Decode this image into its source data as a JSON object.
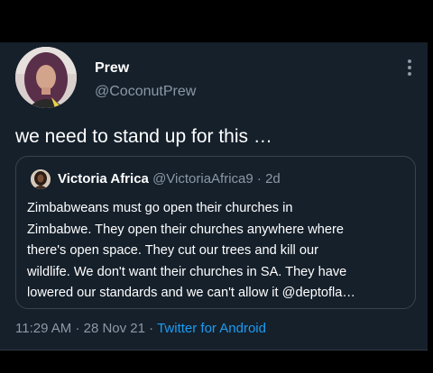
{
  "tweet": {
    "author": {
      "display_name": "Prew",
      "handle": "@CoconutPrew"
    },
    "text": "we need to stand up for this  …",
    "more_icon": "more-vertical-icon",
    "quoted": {
      "author_name": "Victoria Africa",
      "author_handle": "@VictoriaAfrica9",
      "separator": "·",
      "age": "2d",
      "body_lines": [
        "Zimbabweans must go open their churches in",
        "Zimbabwe. They open their churches anywhere where",
        "there's open space. They cut our trees and kill our",
        "wildlife. We don't want their churches in SA. They have",
        "lowered our standards and we can't allow it @deptofla…"
      ]
    },
    "meta": {
      "time": "11:29 AM",
      "separator": "·",
      "date": "28 Nov 21",
      "source": "Twitter for Android"
    }
  },
  "colors": {
    "background": "#15202b",
    "text_primary": "#ffffff",
    "text_secondary": "#8b98a5",
    "link": "#1d9bf0",
    "border": "#38444d"
  }
}
